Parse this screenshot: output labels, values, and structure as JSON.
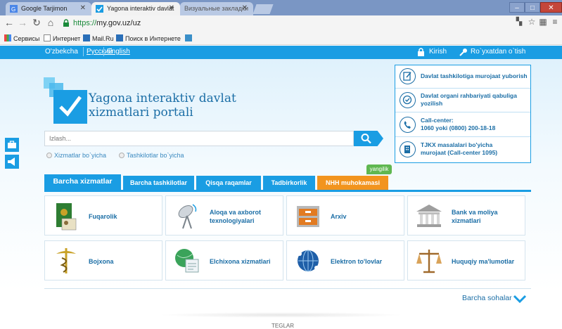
{
  "browser": {
    "tabs": [
      {
        "label": "Google Tarjimon"
      },
      {
        "label": "Yagona interaktiv davlat"
      },
      {
        "label": "Визуальные закладки"
      }
    ],
    "url_scheme": "https://",
    "url_host": "my.gov.uz",
    "url_path": "/uz",
    "bookmarks": [
      "Сервисы",
      "Интернет",
      "Mail.Ru",
      "Поиск в Интернете"
    ]
  },
  "topbar": {
    "languages": [
      "O'zbekcha",
      "Русский",
      "English"
    ],
    "login": "Kirish",
    "register": "Ro`yxatdan o`tish"
  },
  "brand": {
    "title_line1": "Yagona interaktiv davlat",
    "title_line2": "xizmatlari portali"
  },
  "search": {
    "placeholder": "Izlash...",
    "options": [
      "Xizmatlar bo`yicha",
      "Tashkilotlar bo`yicha"
    ]
  },
  "contact_panel": [
    {
      "icon": "edit-icon",
      "lines": [
        "Davlat tashkilotiga murojaat yuborish"
      ]
    },
    {
      "icon": "check-icon",
      "lines": [
        "Davlat organi rahbariyati qabuliga",
        "yozilish"
      ]
    },
    {
      "icon": "phone-icon",
      "lines": [
        "Call-center:",
        "1060 yoki (0800) 200-18-18"
      ]
    },
    {
      "icon": "building-icon",
      "lines": [
        "TJKX masalalari bo'yicha",
        "murojaat (Call-center 1095)"
      ]
    }
  ],
  "tabs": [
    {
      "label": "Barcha xizmatlar",
      "active": true
    },
    {
      "label": "Barcha tashkilotlar"
    },
    {
      "label": "Qisqa raqamlar"
    },
    {
      "label": "Tadbirkorlik"
    },
    {
      "label": "NHH muhokamasi"
    }
  ],
  "new_badge": "yangilik",
  "services": [
    {
      "label": "Fuqarolik",
      "icon": "passport-icon"
    },
    {
      "label": "Aloqa va axborot texnologiyalari",
      "icon": "satellite-dish-icon"
    },
    {
      "label": "Arxiv",
      "icon": "archive-cabinet-icon"
    },
    {
      "label": "Bank va moliya xizmatlari",
      "icon": "bank-icon"
    },
    {
      "label": "Bojxona",
      "icon": "caduceus-icon"
    },
    {
      "label": "Elchixona xizmatlari",
      "icon": "globe-document-icon"
    },
    {
      "label": "Elektron to'lovlar",
      "icon": "globe-network-icon"
    },
    {
      "label": "Huquqiy ma'lumotlar",
      "icon": "scales-icon"
    }
  ],
  "all_areas": "Barcha sohalar",
  "footer_partial": "TEGLAR",
  "colors": {
    "primary": "#1a9de3",
    "dark_blue": "#1b6ea6",
    "orange": "#f2941e",
    "green_badge": "#5fb750"
  }
}
